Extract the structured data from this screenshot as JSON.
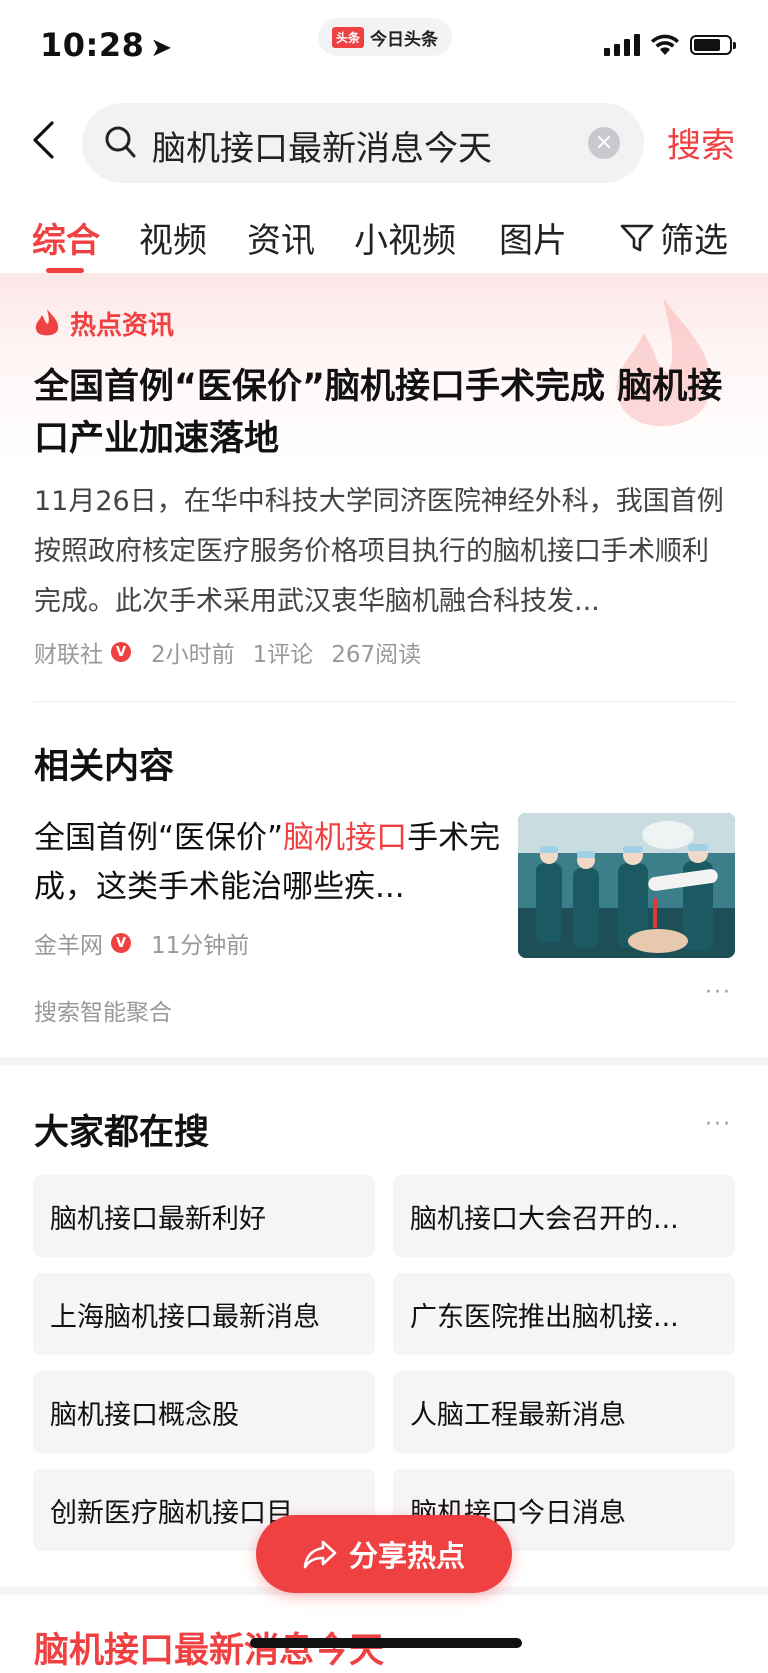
{
  "status_bar": {
    "time": "10:28",
    "app_brand_badge": "头条",
    "app_brand_name": "今日头条"
  },
  "search": {
    "query": "脑机接口最新消息今天",
    "submit_label": "搜索"
  },
  "tabs": [
    {
      "label": "综合",
      "active": true
    },
    {
      "label": "视频"
    },
    {
      "label": "资讯"
    },
    {
      "label": "小视频"
    },
    {
      "label": "图片"
    },
    {
      "label": "筛选"
    }
  ],
  "hot_news": {
    "section_label": "热点资讯",
    "title": "全国首例“医保价”脑机接口手术完成 脑机接口产业加速落地",
    "summary": "11月26日，在华中科技大学同济医院神经外科，我国首例按照政府核定医疗服务价格项目执行的脑机接口手术顺利完成。此次手术采用武汉衷华脑机融合科技发...",
    "source": "财联社",
    "verified_badge": "V",
    "time": "2小时前",
    "comments": "1评论",
    "reads": "267阅读"
  },
  "related": {
    "section_title": "相关内容",
    "headline_pre": "全国首例“医保价”",
    "headline_highlight": "脑机接口",
    "headline_post": "手术完成，这类手术能治哪些疾...",
    "source": "金羊网",
    "verified_badge": "V",
    "time": "11分钟前",
    "aggregation_label": "搜索智能聚合",
    "more": "···"
  },
  "people_searching": {
    "section_title": "大家都在搜",
    "more": "···",
    "items": [
      "脑机接口最新利好",
      "脑机接口大会召开的...",
      "上海脑机接口最新消息",
      "广东医院推出脑机接...",
      "脑机接口概念股",
      "人脑工程最新消息",
      "创新医疗脑机接口目",
      "脑机接口今日消息"
    ]
  },
  "bottom_result_title": "脑机接口最新消息今天",
  "share_button": {
    "label": "分享热点"
  },
  "colors": {
    "accent": "#f04142",
    "chip_bg": "#f5f5f7",
    "muted_text": "#999999"
  }
}
